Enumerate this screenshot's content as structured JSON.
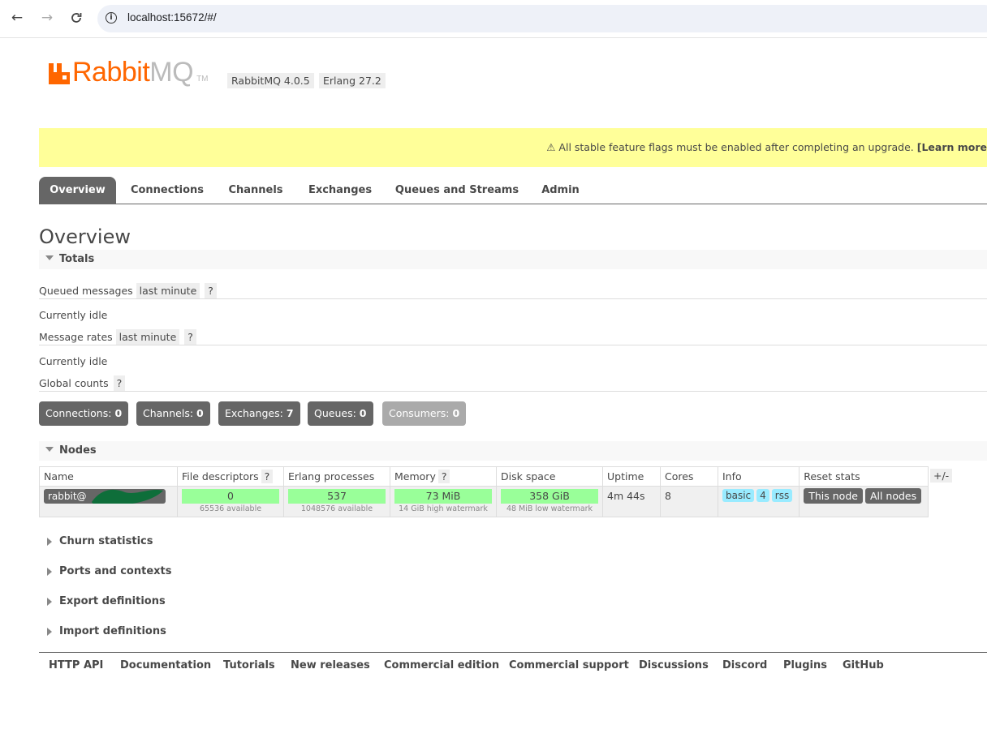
{
  "browser": {
    "back_icon": "arrow-left-icon",
    "forward_icon": "arrow-right-icon",
    "reload_icon": "reload-icon",
    "url": "localhost:15672/#/"
  },
  "header": {
    "logo_primary": "Rabbit",
    "logo_secondary": "MQ",
    "logo_tm": "TM",
    "version": "RabbitMQ 4.0.5",
    "erlang": "Erlang 27.2"
  },
  "banner": {
    "text": "⚠ All stable feature flags must be enabled after completing an upgrade.",
    "link": "[Learn more"
  },
  "tabs": [
    {
      "label": "Overview",
      "active": true
    },
    {
      "label": "Connections"
    },
    {
      "label": "Channels"
    },
    {
      "label": "Exchanges"
    },
    {
      "label": "Queues and Streams"
    },
    {
      "label": "Admin"
    }
  ],
  "page_title": "Overview",
  "totals": {
    "title": "Totals",
    "queued_messages": "Queued messages",
    "queued_range": "last minute",
    "help": "?",
    "queued_status": "Currently idle",
    "message_rates": "Message rates",
    "rates_range": "last minute",
    "rates_status": "Currently idle",
    "global_counts": "Global counts"
  },
  "counts": [
    {
      "label": "Connections:",
      "value": "0"
    },
    {
      "label": "Channels:",
      "value": "0"
    },
    {
      "label": "Exchanges:",
      "value": "7"
    },
    {
      "label": "Queues:",
      "value": "0"
    },
    {
      "label": "Consumers:",
      "value": "0"
    }
  ],
  "nodes": {
    "title": "Nodes",
    "columns": [
      "Name",
      "File descriptors",
      "Erlang processes",
      "Memory",
      "Disk space",
      "Uptime",
      "Cores",
      "Info",
      "Reset stats"
    ],
    "help": "?",
    "row": {
      "name": "rabbit@",
      "file_descriptors": "0",
      "fd_available": "65536 available",
      "erlang_processes": "537",
      "proc_available": "1048576 available",
      "memory": "73 MiB",
      "memory_watermark": "14 GiB high watermark",
      "disk": "358 GiB",
      "disk_watermark": "48 MiB low watermark",
      "uptime": "4m 44s",
      "cores": "8",
      "info_tags": [
        "basic",
        "4",
        "rss"
      ],
      "reset_this": "This node",
      "reset_all": "All nodes"
    },
    "toggle": "+/-"
  },
  "collapsed_sections": [
    "Churn statistics",
    "Ports and contexts",
    "Export definitions",
    "Import definitions"
  ],
  "footer_links": [
    "HTTP API",
    "Documentation",
    "Tutorials",
    "New releases",
    "Commercial edition",
    "Commercial support",
    "Discussions",
    "Discord",
    "Plugins",
    "GitHub"
  ],
  "colors": {
    "brand_orange": "#ff6600",
    "banner_yellow": "#ffff99",
    "bar_green": "#99ff99",
    "tag_blue": "#99ebff",
    "dark_gray": "#666666"
  }
}
